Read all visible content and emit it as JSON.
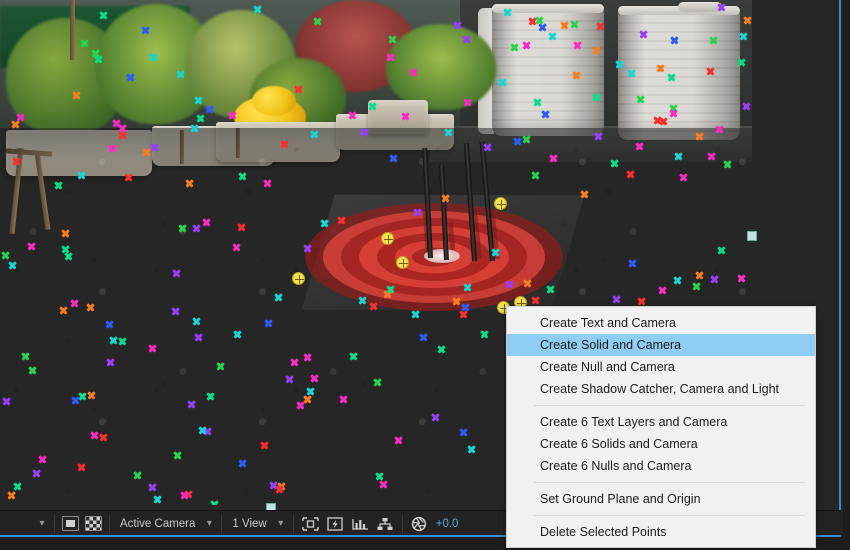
{
  "app": {
    "name": "After Effects 3D Camera Tracker",
    "viewer_panel": "composition-viewer"
  },
  "context_menu": {
    "name": "3d-camera-tracker-context-menu",
    "selected_index": 1,
    "groups": [
      {
        "items": [
          {
            "label": "Create Text and Camera",
            "selected": false
          },
          {
            "label": "Create Solid and Camera",
            "selected": true
          },
          {
            "label": "Create Null and Camera",
            "selected": false
          },
          {
            "label": "Create Shadow Catcher, Camera and Light",
            "selected": false
          }
        ]
      },
      {
        "items": [
          {
            "label": "Create 6 Text Layers and Camera",
            "selected": false
          },
          {
            "label": "Create 6 Solids and Camera",
            "selected": false
          },
          {
            "label": "Create 6 Nulls and Camera",
            "selected": false
          }
        ]
      },
      {
        "items": [
          {
            "label": "Set Ground Plane and Origin",
            "selected": false
          }
        ]
      },
      {
        "items": [
          {
            "label": "Delete Selected Points",
            "selected": false
          }
        ]
      }
    ],
    "colors": {
      "background": "#f1f1f1",
      "highlight": "#8fcdf4",
      "text": "#1b1b1b",
      "separator": "#dcdcdc"
    }
  },
  "toolbar": {
    "magnification_chevron": "chevron-down",
    "toggle_transparency_grid_icon": "transparency-grid-icon",
    "toggle_mask_icon": "mask-shape-icon",
    "view_select": {
      "value": "Active Camera",
      "chevron": "chevron-down"
    },
    "view_layout_select": {
      "value": "1 View",
      "chevron": "chevron-down"
    },
    "region_of_interest_icon": "region-of-interest-icon",
    "transparency_toggle_icon": "fast-previews-icon",
    "timeline_graph_icon": "timeline-graph-icon",
    "flowchart_icon": "comp-flowchart-icon",
    "exposure_icon": "exposure-aperture-icon",
    "exposure_value": "+0.0"
  },
  "overlay": {
    "gizmo_name": "3d-tracker-target-bullseye",
    "ring_colors": [
      "#961a18",
      "#e8483e"
    ],
    "selected_point_color": "#f5e04a",
    "selected_points_count": 6
  },
  "tracking_points": {
    "palette": [
      "#ff2d2d",
      "#22d84a",
      "#2b5cff",
      "#ff28c8",
      "#13d7d7",
      "#9a3dff",
      "#ff7b1a",
      "#00e08a"
    ],
    "count_visible": 210
  },
  "selection_handles": {
    "right_handle": "comp-right-resize-handle",
    "bottom_handle": "comp-bottom-resize-handle"
  }
}
